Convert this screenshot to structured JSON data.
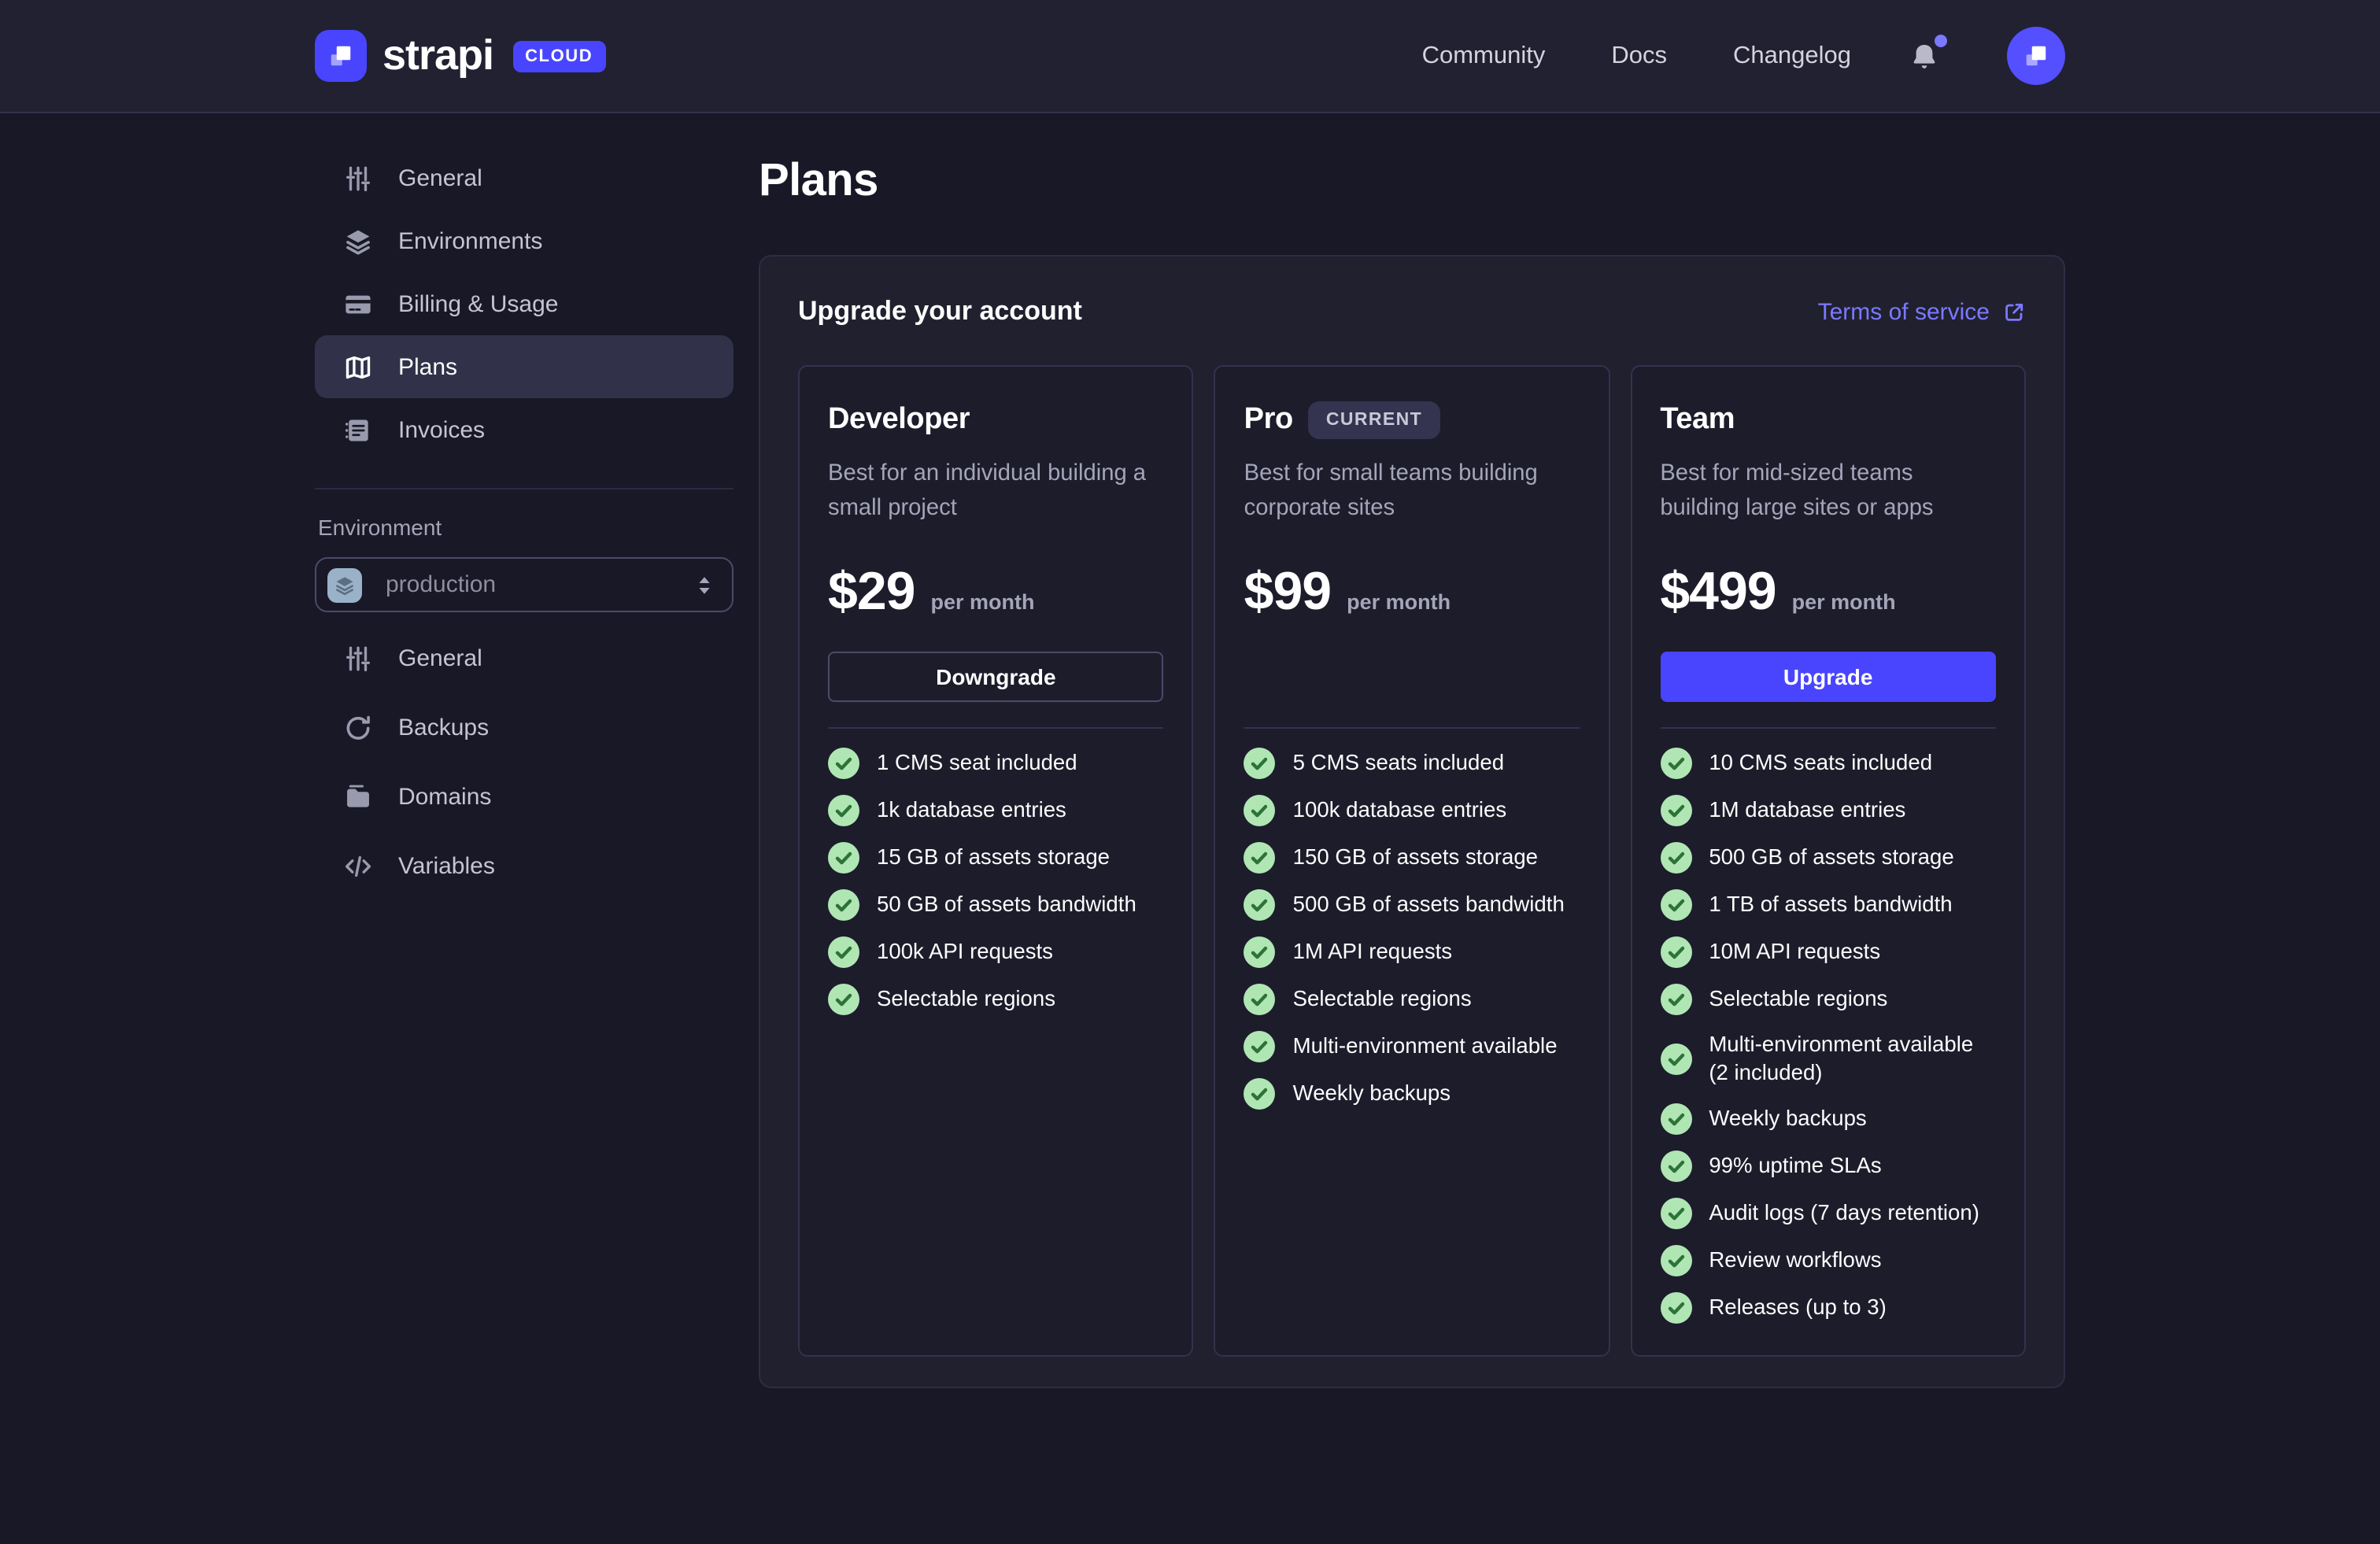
{
  "header": {
    "logo_text": "strapi",
    "logo_badge": "CLOUD",
    "nav": [
      {
        "label": "Community"
      },
      {
        "label": "Docs"
      },
      {
        "label": "Changelog"
      }
    ]
  },
  "sidebar": {
    "project_items": [
      {
        "label": "General",
        "icon": "sliders-icon"
      },
      {
        "label": "Environments",
        "icon": "layers-icon"
      },
      {
        "label": "Billing & Usage",
        "icon": "credit-card-icon"
      },
      {
        "label": "Plans",
        "icon": "book-icon",
        "active": true
      },
      {
        "label": "Invoices",
        "icon": "invoice-icon"
      }
    ],
    "environment_label": "Environment",
    "environment_select": {
      "value": "production",
      "icon": "layers-icon"
    },
    "environment_items": [
      {
        "label": "General",
        "icon": "sliders-icon"
      },
      {
        "label": "Backups",
        "icon": "refresh-icon"
      },
      {
        "label": "Domains",
        "icon": "folder-icon"
      },
      {
        "label": "Variables",
        "icon": "code-icon"
      }
    ]
  },
  "main": {
    "page_title": "Plans",
    "card_title": "Upgrade your account",
    "terms_link": "Terms of service",
    "plans": [
      {
        "name": "Developer",
        "description": "Best for an individual building a small project",
        "price": "$29",
        "period": "per month",
        "action_label": "Downgrade",
        "features": [
          "1 CMS seat included",
          "1k database entries",
          "15 GB of assets storage",
          "50 GB of assets bandwidth",
          "100k API requests",
          "Selectable regions"
        ]
      },
      {
        "name": "Pro",
        "badge": "CURRENT",
        "description": "Best for small teams building corporate sites",
        "price": "$99",
        "period": "per month",
        "action_label": null,
        "features": [
          "5 CMS seats included",
          "100k database entries",
          "150 GB of assets storage",
          "500 GB of assets bandwidth",
          "1M API requests",
          "Selectable regions",
          "Multi-environment available",
          "Weekly backups"
        ]
      },
      {
        "name": "Team",
        "description": "Best for mid-sized teams building large sites or apps",
        "price": "$499",
        "period": "per month",
        "action_label": "Upgrade",
        "features": [
          "10 CMS seats included",
          "1M database entries",
          "500 GB of assets storage",
          "1 TB of assets bandwidth",
          "10M API requests",
          "Selectable regions",
          "Multi-environment available (2 included)",
          "Weekly backups",
          "99% uptime SLAs",
          "Audit logs (7 days retention)",
          "Review workflows",
          "Releases (up to 3)"
        ]
      }
    ]
  },
  "colors": {
    "accent": "#4945ff",
    "link": "#7b79ff",
    "page_bg": "#181826",
    "header_bg": "#212132",
    "card_bg": "#20202f",
    "plan_card_bg": "#1c1c2b",
    "border": "#32324d",
    "text_muted": "#a5a5ba",
    "success_circle": "#b0e6b4",
    "success_check": "#2d7338",
    "env_icon_bg": "#9ab2c8"
  }
}
